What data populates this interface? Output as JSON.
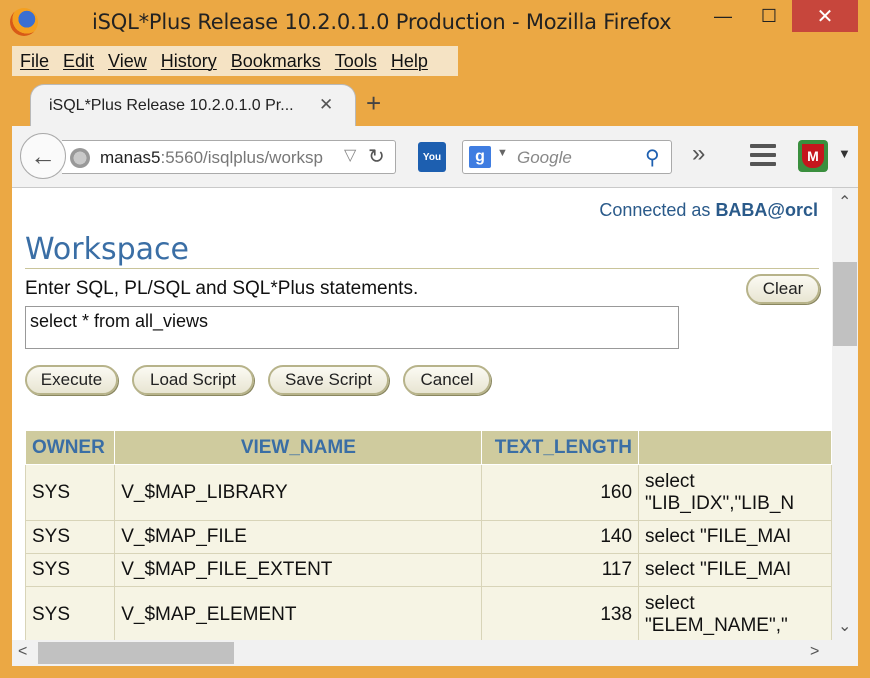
{
  "window": {
    "title": "iSQL*Plus Release 10.2.0.1.0 Production - Mozilla Firefox",
    "min_glyph": "—",
    "max_glyph": "☐",
    "close_glyph": "✕"
  },
  "menubar": [
    "File",
    "Edit",
    "View",
    "History",
    "Bookmarks",
    "Tools",
    "Help"
  ],
  "tab": {
    "label": "iSQL*Plus Release 10.2.0.1.0 Pr...",
    "close_glyph": "✕",
    "new_tab_glyph": "+"
  },
  "navbar": {
    "back_glyph": "←",
    "url_host": "manas5",
    "url_rest": ":5560/isqlplus/worksp",
    "dropdown_glyph": "▽",
    "reload_glyph": "↻",
    "search_engine_glyph": "g",
    "search_drop_glyph": "▼",
    "search_placeholder": "Google",
    "search_glyph": "⚲",
    "overflow_glyph": "»",
    "addon_glyph": "M",
    "addon_drop_glyph": "▼",
    "youtube_label": "You"
  },
  "page": {
    "connected_prefix": "Connected as ",
    "connected_user": "BABA@orcl",
    "title": "Workspace",
    "instructions": "Enter SQL, PL/SQL and SQL*Plus statements.",
    "clear_label": "Clear",
    "sql_text": "select * from all_views",
    "buttons": {
      "execute": "Execute",
      "load": "Load Script",
      "save": "Save Script",
      "cancel": "Cancel"
    }
  },
  "results": {
    "columns": [
      "OWNER",
      "VIEW_NAME",
      "TEXT_LENGTH",
      ""
    ],
    "rows": [
      {
        "owner": "SYS",
        "view_name": "V_$MAP_LIBRARY",
        "text_length": "160",
        "text_1": "select",
        "text_2": "\"LIB_IDX\",\"LIB_N"
      },
      {
        "owner": "SYS",
        "view_name": "V_$MAP_FILE",
        "text_length": "140",
        "text_1": "select \"FILE_MAI"
      },
      {
        "owner": "SYS",
        "view_name": "V_$MAP_FILE_EXTENT",
        "text_length": "117",
        "text_1": "select \"FILE_MAI"
      },
      {
        "owner": "SYS",
        "view_name": "V_$MAP_ELEMENT",
        "text_length": "138",
        "text_1": "select",
        "text_2": "\"ELEM_NAME\",\""
      }
    ]
  },
  "scrollbars": {
    "up_glyph": "⌃",
    "down_glyph": "⌄",
    "left_glyph": "<",
    "right_glyph": ">"
  },
  "colors": {
    "frame": "#eba844",
    "close_button": "#c7463c",
    "link_blue": "#3a6ea5",
    "table_header": "#cfcb9e",
    "table_cell": "#f6f4e4"
  }
}
